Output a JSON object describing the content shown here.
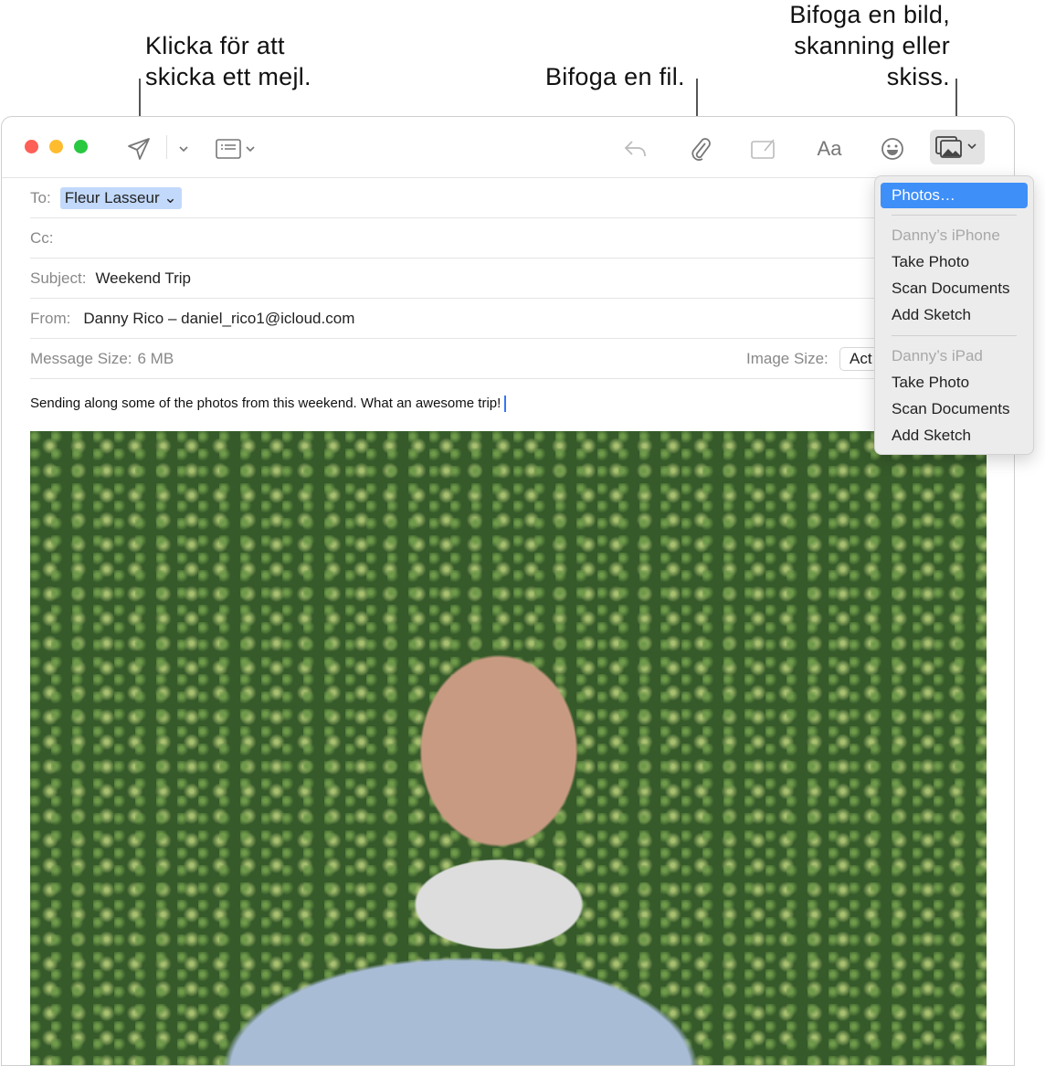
{
  "callouts": {
    "send": [
      "Klicka för att",
      "skicka ett mejl."
    ],
    "attach": "Bifoga en fil.",
    "photo": [
      "Bifoga en bild,",
      "skanning eller",
      "skiss."
    ]
  },
  "toolbar": {
    "icons": [
      "send-icon",
      "chevron-down-icon",
      "header-fields-icon",
      "reply-icon",
      "paperclip-icon",
      "markup-icon",
      "format-icon",
      "emoji-icon",
      "photo-browser-icon"
    ],
    "format_label": "Aa"
  },
  "colors": {
    "close": "#fe5f57",
    "minimize": "#febc2e",
    "zoom": "#28c840",
    "highlight": "#3f8ff8",
    "chip": "#c2d9fb"
  },
  "fields": {
    "to_label": "To:",
    "to_value": "Fleur Lasseur",
    "cc_label": "Cc:",
    "subject_label": "Subject:",
    "subject_value": "Weekend Trip",
    "from_label": "From:",
    "from_value": "Danny Rico – daniel_rico1@icloud.com",
    "size_label": "Message Size:",
    "size_value": "6 MB",
    "image_size_label": "Image Size:",
    "image_size_value": "Act"
  },
  "body": {
    "text": "Sending along some of the photos from this weekend. What an awesome trip!"
  },
  "menu": {
    "photos": "Photos…",
    "iphone": "Danny’s iPhone",
    "ipad": "Danny’s iPad",
    "take": "Take Photo",
    "scan": "Scan Documents",
    "sketch": "Add Sketch"
  }
}
